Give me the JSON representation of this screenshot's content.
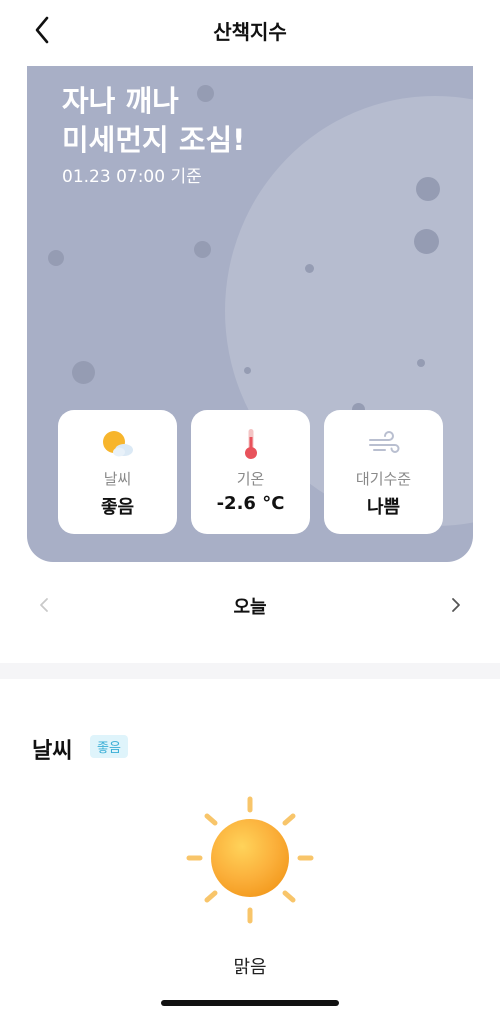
{
  "header": {
    "title": "산책지수",
    "back_icon": "chevron-left-icon"
  },
  "hero": {
    "title": "자나 깨나\n미세먼지 조심!",
    "date": "01.23 07:00 기준",
    "background_color": "#a8afc6"
  },
  "cards": [
    {
      "icon": "partly-cloudy-icon",
      "label": "날씨",
      "value": "좋음"
    },
    {
      "icon": "thermometer-icon",
      "label": "기온",
      "value": "-2.6 °C"
    },
    {
      "icon": "wind-icon",
      "label": "대기수준",
      "value": "나쁨"
    }
  ],
  "day_nav": {
    "label": "오늘",
    "prev_icon": "chevron-left-icon",
    "next_icon": "chevron-right-icon"
  },
  "weather_section": {
    "title": "날씨",
    "badge": "좋음",
    "badge_color": "#3aaed6",
    "icon": "sun-icon",
    "description": "맑음"
  }
}
